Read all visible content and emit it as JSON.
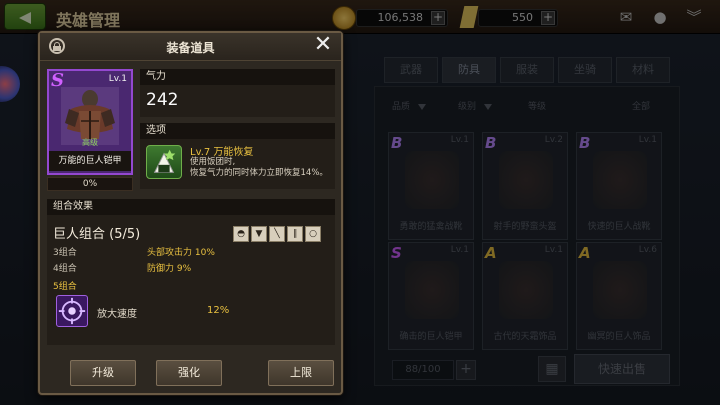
{
  "header": {
    "title": "英雄管理",
    "gold": "106,538",
    "tickets": "550",
    "icons": [
      "mail-icon",
      "chat-icon",
      "collapse-icon"
    ]
  },
  "inventory": {
    "tabs": [
      "武器",
      "防具",
      "服装",
      "坐骑",
      "材料"
    ],
    "active_tab": "防具",
    "filters": [
      "品质",
      "级别",
      "等级",
      "全部"
    ],
    "cards": [
      {
        "grade": "B",
        "level": "Lv.1",
        "name": "勇敢的猛禽战靴",
        "grade_color": "#b888ff"
      },
      {
        "grade": "B",
        "level": "Lv.2",
        "name": "射手的野蛮头盔",
        "grade_color": "#b888ff"
      },
      {
        "grade": "B",
        "level": "Lv.1",
        "name": "快速的巨人战靴",
        "grade_color": "#b888ff"
      },
      {
        "grade": "S",
        "level": "Lv.1",
        "name": "确击的巨人铠甲",
        "grade_color": "#d060ff"
      },
      {
        "grade": "A",
        "level": "Lv.1",
        "name": "古代的天霜饰品",
        "grade_color": "#e8c040"
      },
      {
        "grade": "A",
        "level": "Lv.6",
        "name": "幽冥的巨人饰品",
        "grade_color": "#e8c040"
      }
    ],
    "count": "88/100",
    "plus": "+",
    "sell_label": "快速出售"
  },
  "dialog": {
    "title": "装备道具",
    "item": {
      "grade": "S",
      "level": "Lv.1",
      "set_tag": "高级",
      "name": "万能的巨人铠甲",
      "percent": "0%"
    },
    "power": {
      "label": "气力",
      "value": "242"
    },
    "option": {
      "label": "选项",
      "title": "Lv.7 万能恢复",
      "desc_line1": "使用饭团时,",
      "desc_line2": "恢复气力的同时体力立即恢复14%。"
    },
    "set": {
      "label": "组合效果",
      "name": "巨人组合 (5/5)",
      "slot_icons": [
        "helmet-icon",
        "armor-icon",
        "weapon-icon",
        "boots-icon",
        "ring-icon"
      ],
      "bonuses": [
        {
          "label": "3组合",
          "effect": "头部攻击力 10%"
        },
        {
          "label": "4组合",
          "effect": "防御力 9%"
        }
      ],
      "combo5_label": "5组合",
      "buff_name": "放大速度",
      "buff_value": "12%"
    },
    "buttons": {
      "upgrade": "升级",
      "enhance": "强化",
      "limit": "上限"
    }
  }
}
